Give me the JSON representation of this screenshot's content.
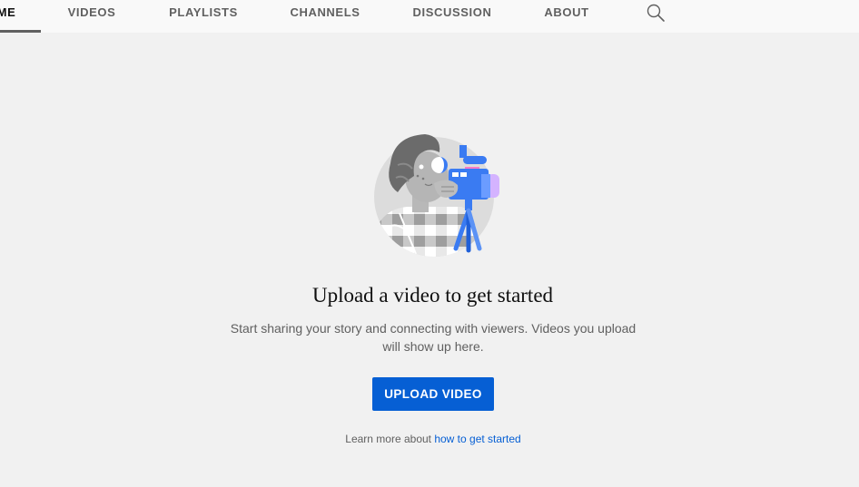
{
  "tabs": [
    {
      "label": "ME",
      "active": true
    },
    {
      "label": "VIDEOS"
    },
    {
      "label": "PLAYLISTS"
    },
    {
      "label": "CHANNELS"
    },
    {
      "label": "DISCUSSION"
    },
    {
      "label": "ABOUT"
    }
  ],
  "search_icon": "search-icon",
  "empty_state": {
    "illustration": "camera-operator-illustration",
    "headline": "Upload a video to get started",
    "subtext": "Start sharing your story and connecting with viewers. Videos you upload will show up here.",
    "upload_button": "UPLOAD VIDEO",
    "learn_more_prefix": "Learn more about ",
    "learn_more_link": "how to get started"
  },
  "colors": {
    "accent": "#065fd4",
    "background": "#f1f1f1",
    "tabbar": "#f9f9f9"
  }
}
